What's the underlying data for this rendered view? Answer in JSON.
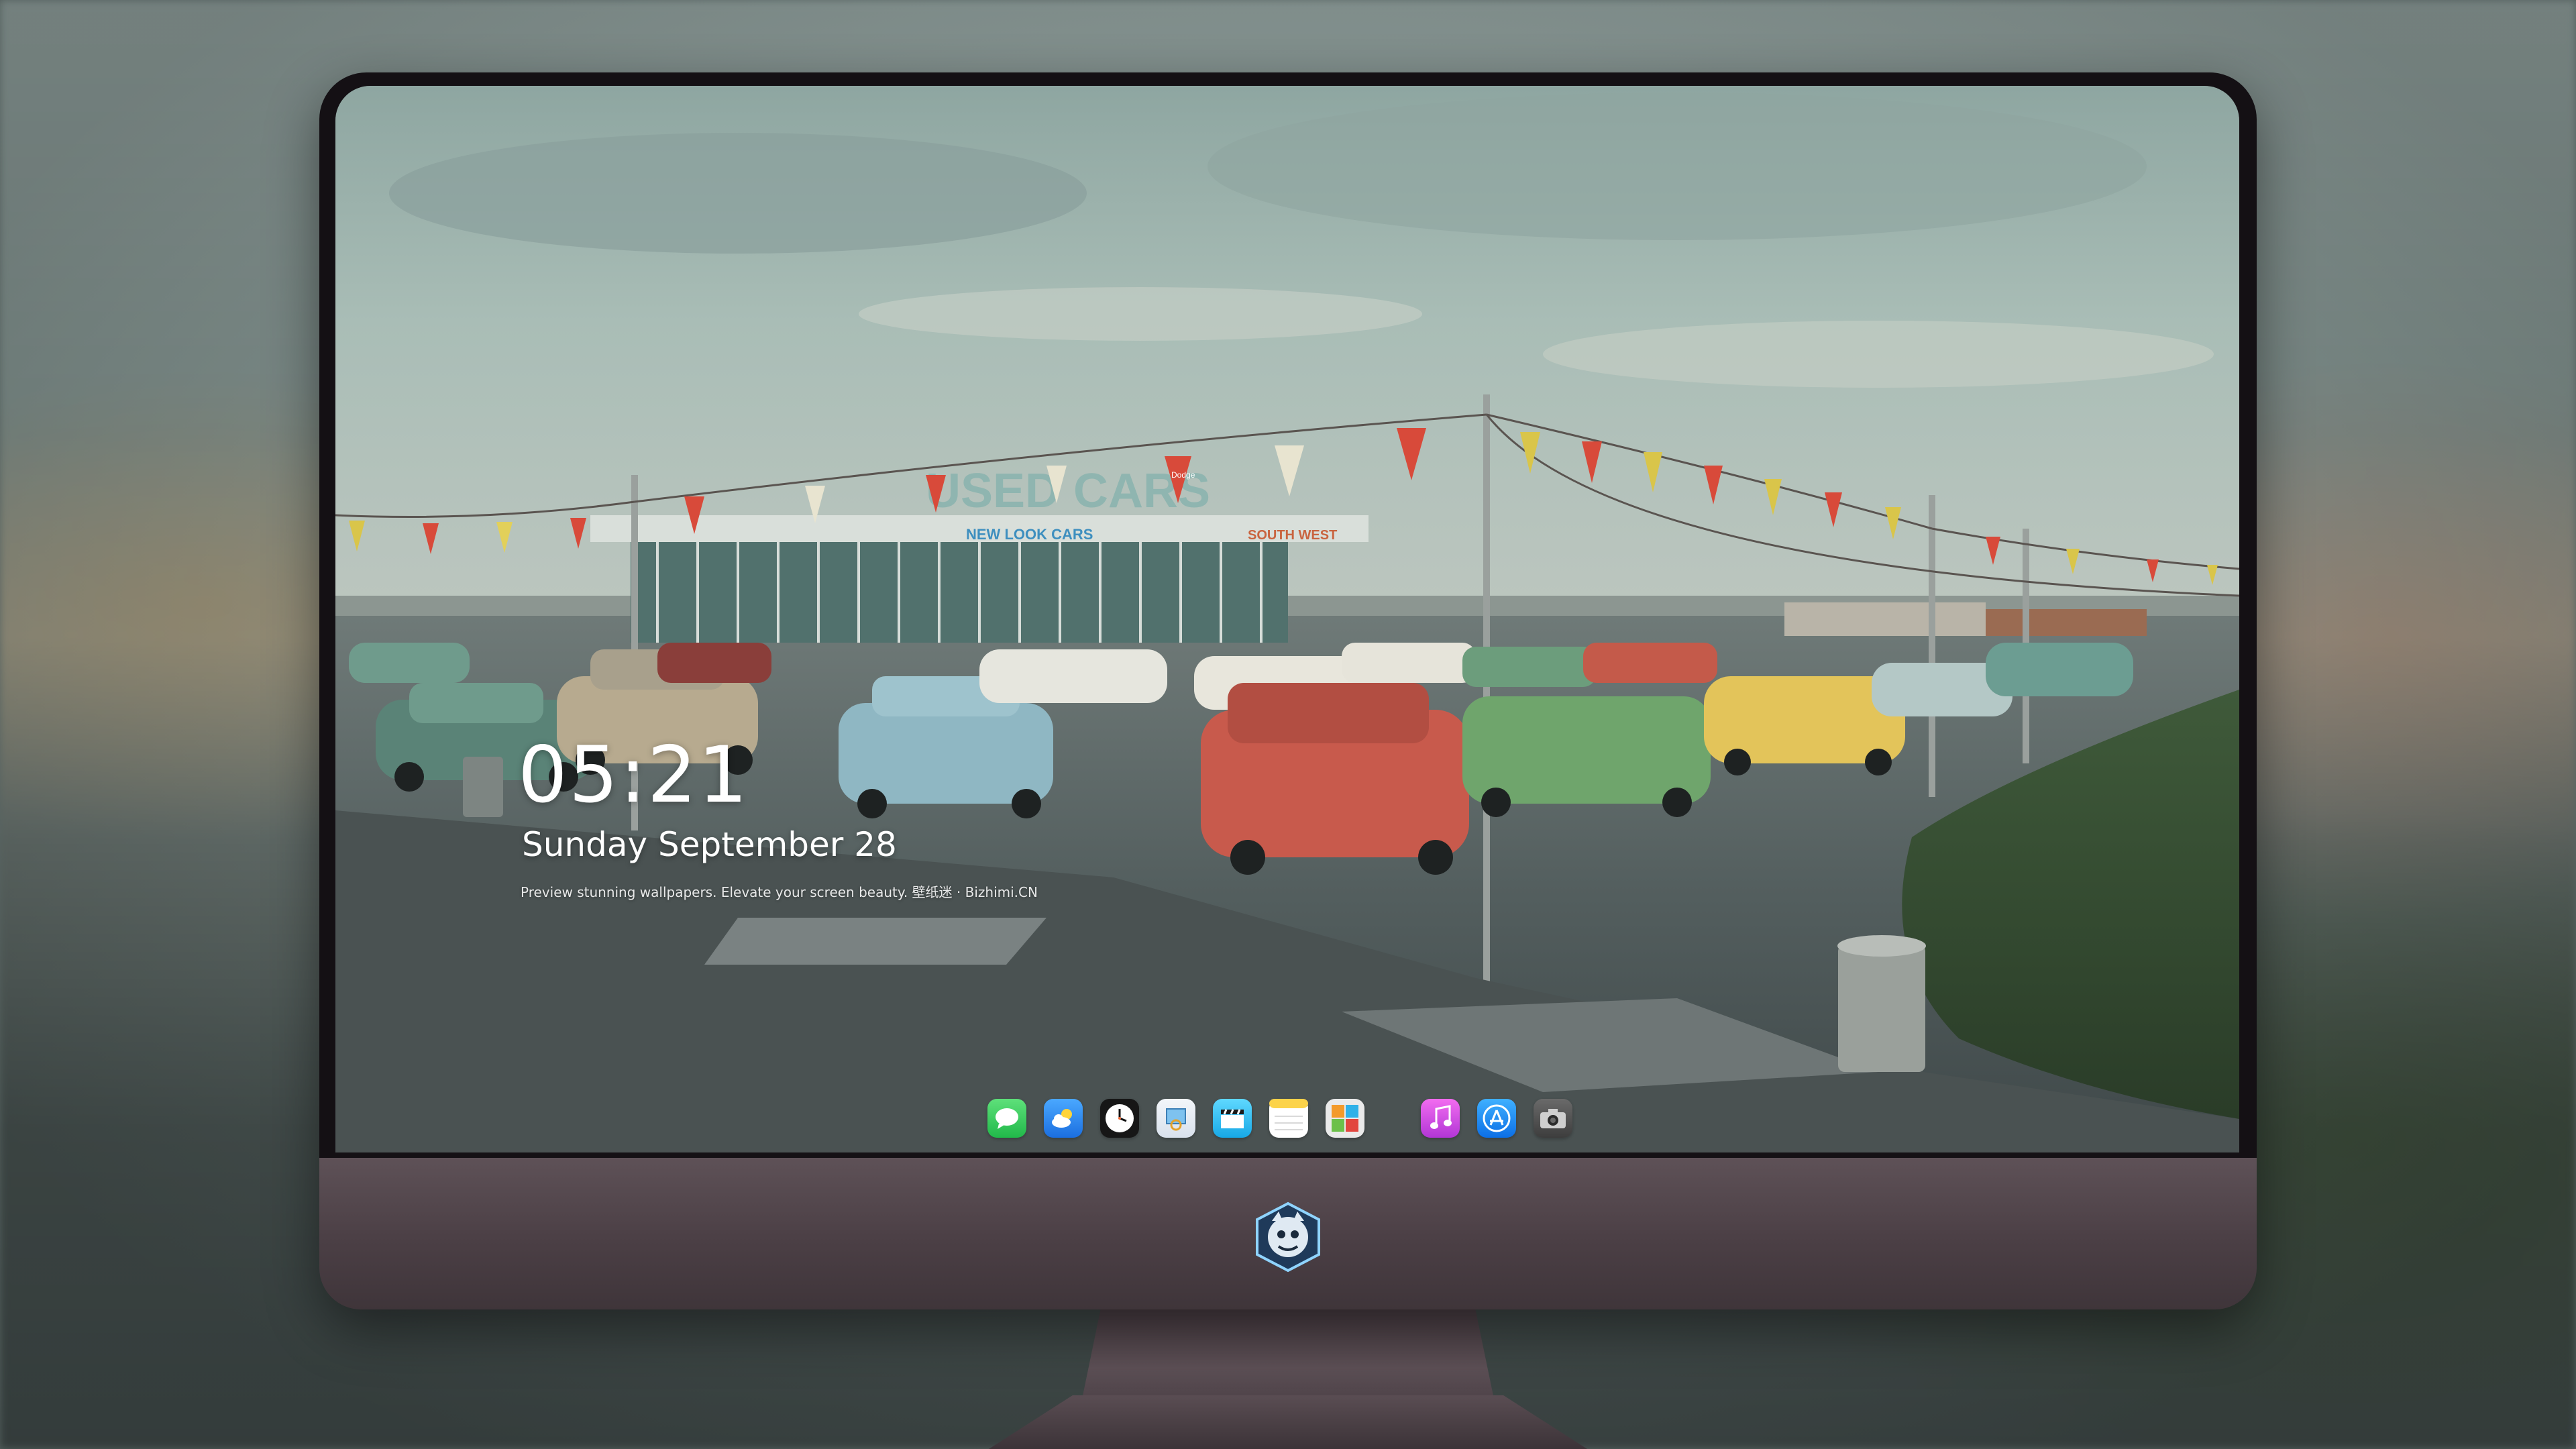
{
  "lockscreen": {
    "time": "05:21",
    "date": "Sunday September  28",
    "caption": "Preview stunning wallpapers. Elevate your screen beauty. 壁纸迷 · Bizhimi.CN"
  },
  "wallpaper": {
    "signs": {
      "main": "USED CARS",
      "sub": "NEW LOOK CARS",
      "side": "SOUTH WEST"
    },
    "pennant_label": "Dodge"
  },
  "dock": {
    "apps": [
      {
        "name": "messages",
        "icon": "message-bubble-icon",
        "color": "#2fd158"
      },
      {
        "name": "weather",
        "icon": "cloud-sun-icon",
        "color": "#2c8cf2"
      },
      {
        "name": "clock",
        "icon": "clock-icon",
        "color": "#1c1c1c"
      },
      {
        "name": "preview",
        "icon": "preview-icon",
        "color": "#e9eef5"
      },
      {
        "name": "clips",
        "icon": "clapperboard-icon",
        "color": "#35c6f4"
      },
      {
        "name": "notes",
        "icon": "notes-icon",
        "color": "#fcd34a"
      },
      {
        "name": "photo-booth",
        "icon": "photo-grid-icon",
        "color": "#e8e8e8"
      },
      {
        "name": "music",
        "icon": "music-note-icon",
        "color": "#d94bd6"
      },
      {
        "name": "app-store",
        "icon": "app-store-icon",
        "color": "#1c8ef7"
      },
      {
        "name": "camera",
        "icon": "camera-icon",
        "color": "#555555"
      }
    ]
  },
  "colors": {
    "sky": "#a9bdb6",
    "monitor_chin": "#4e4248",
    "bezel": "#141014"
  }
}
